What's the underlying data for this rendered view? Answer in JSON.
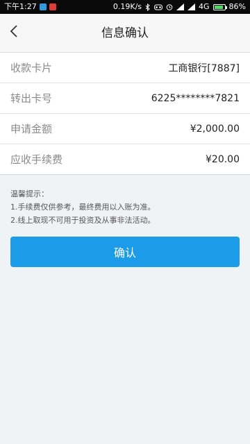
{
  "status_bar": {
    "time": "下午1:27",
    "network_speed": "0.19K/s",
    "network_type": "4G",
    "battery_percent": "86%",
    "battery_level": 0.86
  },
  "nav": {
    "title": "信息确认",
    "back_icon": "chevron-left-icon"
  },
  "info": {
    "rows": [
      {
        "label": "收款卡片",
        "value": "工商银行[7887]"
      },
      {
        "label": "转出卡号",
        "value": "6225********7821"
      },
      {
        "label": "申请金额",
        "value": "¥2,000.00"
      },
      {
        "label": "应收手续费",
        "value": "¥20.00"
      }
    ]
  },
  "tips": {
    "title": "温馨提示：",
    "lines": [
      "1.手续费仅供参考，最终费用以入账为准。",
      "2.线上取现不可用于投资及从事非法活动。"
    ]
  },
  "confirm": {
    "label": "确认"
  },
  "colors": {
    "accent": "#1b9be8",
    "background": "#f0f3f6"
  }
}
